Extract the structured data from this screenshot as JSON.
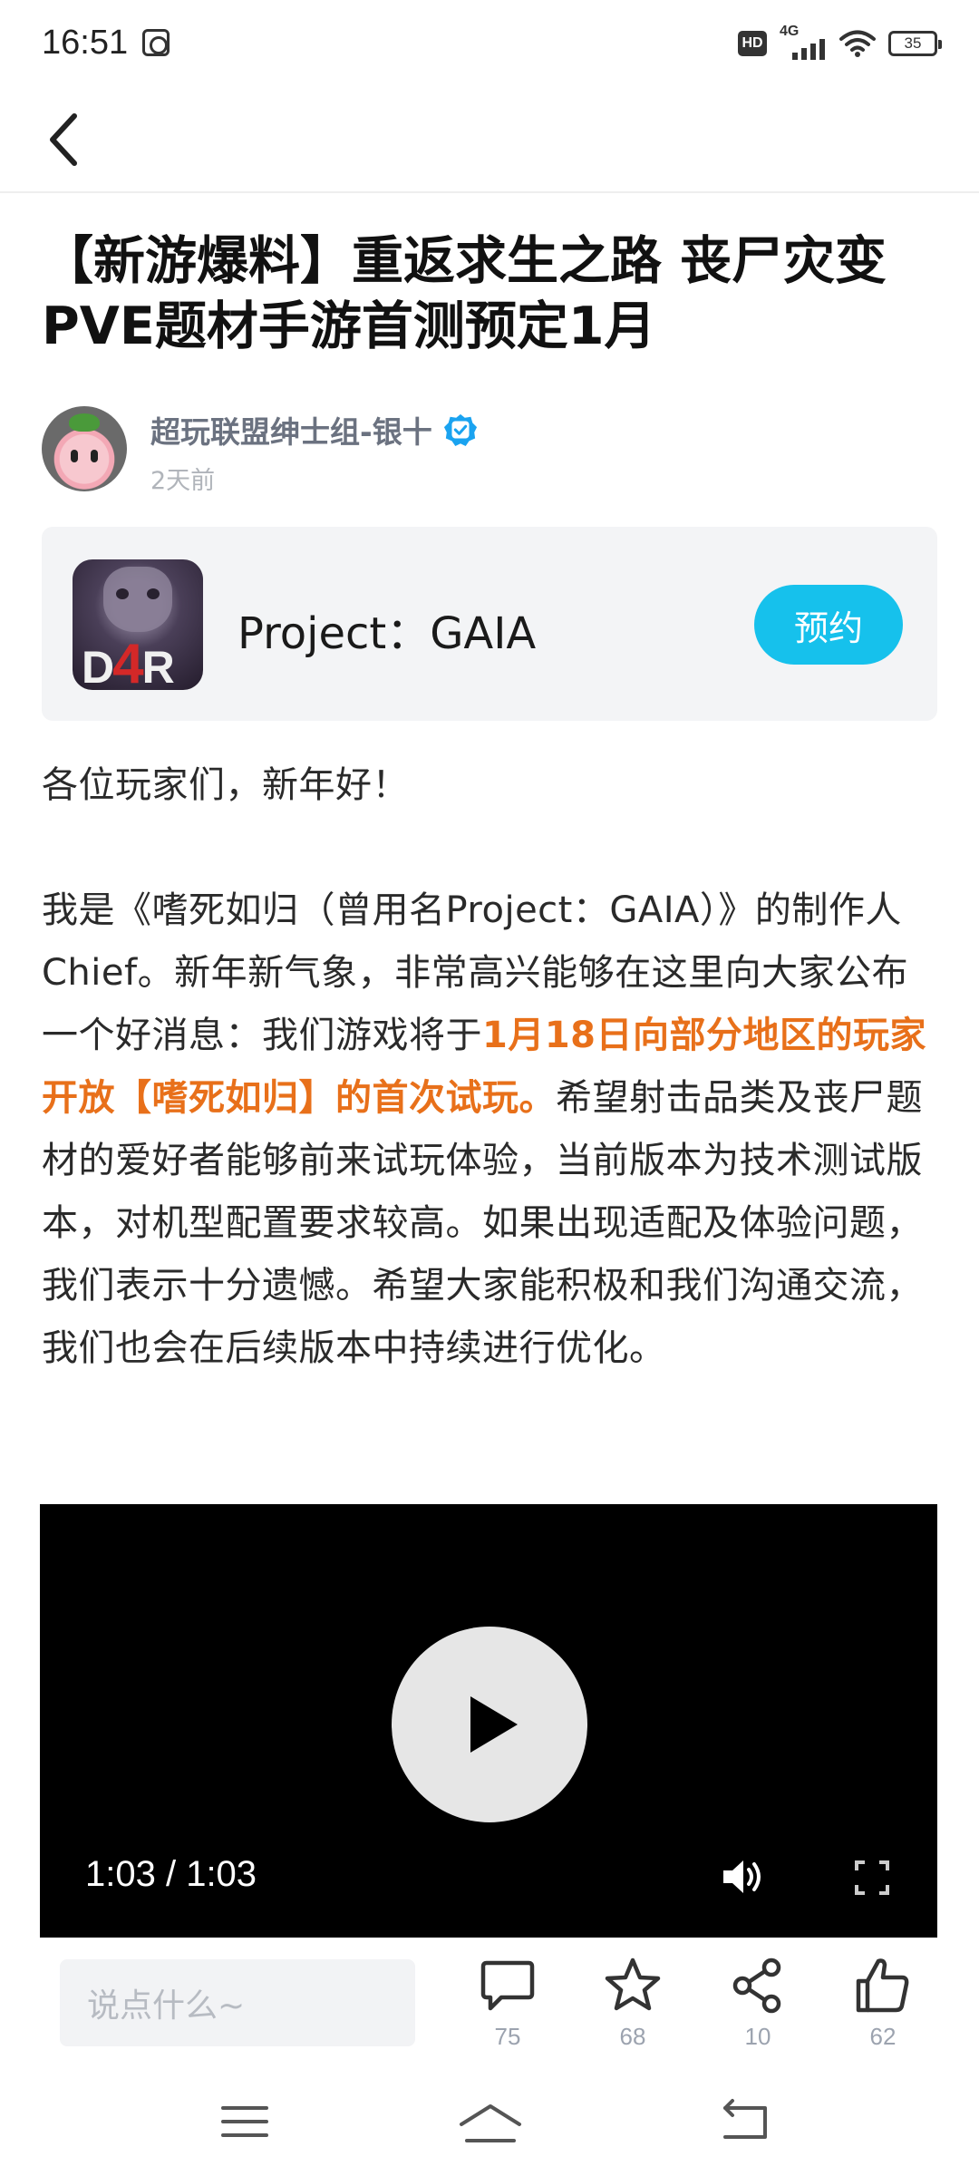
{
  "status_bar": {
    "time": "16:51",
    "hd": "HD",
    "network": "4G",
    "battery": "35"
  },
  "article": {
    "title": "【新游爆料】重返求生之路 丧尸灾变PVE题材手游首测预定1月",
    "author_name": "超玩联盟绅士组-银十",
    "author_time": "2天前"
  },
  "game_card": {
    "logo_text_left": "D",
    "logo_text_mid": "4",
    "logo_text_right": "R",
    "name": "Project：GAIA",
    "reserve_label": "预约"
  },
  "body": {
    "greeting": "各位玩家们，新年好！",
    "para_start": "我是《嗜死如归（曾用名Project：GAIA）》的制作人Chief。新年新气象，非常高兴能够在这里向大家公布一个好消息：我们游戏将于",
    "para_highlight": "1月18日向部分地区的玩家开放【嗜死如归】的首次试玩。",
    "para_end": "希望射击品类及丧尸题材的爱好者能够前来试玩体验，当前版本为技术测试版本，对机型配置要求较高。如果出现适配及体验问题，我们表示十分遗憾。希望大家能积极和我们沟通交流，我们也会在后续版本中持续进行优化。"
  },
  "video": {
    "time": "1:03 / 1:03"
  },
  "action_bar": {
    "comment_placeholder": "说点什么~",
    "comment_count": "75",
    "favorite_count": "68",
    "share_count": "10",
    "like_count": "62"
  },
  "colors": {
    "accent": "#16c1ec",
    "highlight": "#e8701a",
    "verified": "#1aa3f0"
  }
}
